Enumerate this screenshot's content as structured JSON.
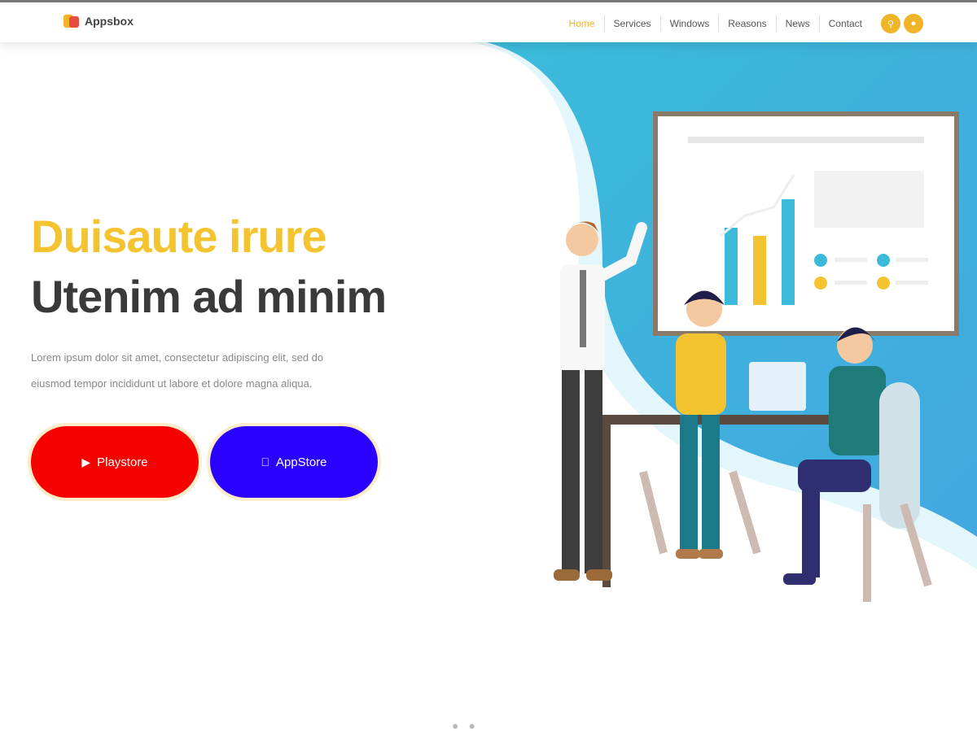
{
  "header": {
    "logo_text": "Appsbox",
    "nav": [
      {
        "label": "Home",
        "active": true
      },
      {
        "label": "Services"
      },
      {
        "label": "Windows"
      },
      {
        "label": "Reasons"
      },
      {
        "label": "News"
      },
      {
        "label": "Contact"
      }
    ],
    "circle_icons": [
      "search-icon",
      "cart-icon"
    ]
  },
  "hero": {
    "title_line_1": "Duisaute irure",
    "title_line_2": "Utenim ad minim",
    "text_line_1": "Lorem ipsum dolor sit amet, consectetur adipiscing elit, sed do",
    "text_line_2": "eiusmod tempor incididunt ut labore et dolore magna aliqua.",
    "primary_button": "Playstore",
    "secondary_button": "AppStore"
  },
  "colors": {
    "accent": "#f4c430",
    "primary_button": "#f70000",
    "secondary_button": "#2a00ff",
    "hero_blue": "#3bbbd9"
  }
}
